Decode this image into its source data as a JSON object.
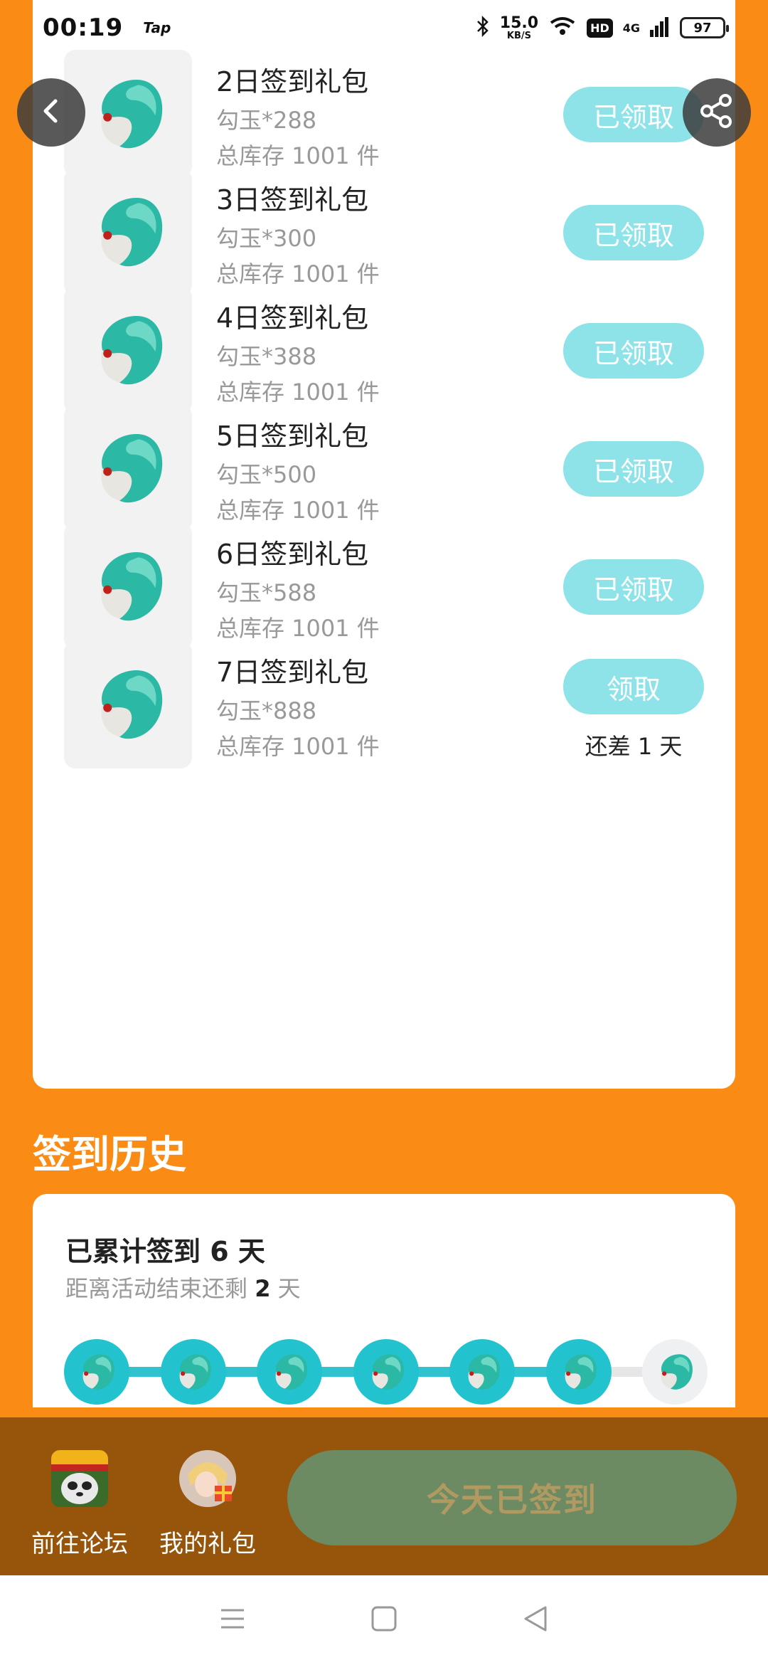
{
  "status_bar": {
    "time": "00:19",
    "app_tag": "Tap",
    "net_speed_value": "15.0",
    "net_speed_unit": "KB/S",
    "hd": "HD",
    "network": "4G",
    "battery": "97"
  },
  "packs": [
    {
      "title": "2日签到礼包",
      "item": "勾玉*288",
      "stock": "总库存 1001 件",
      "button": "已领取",
      "note": ""
    },
    {
      "title": "3日签到礼包",
      "item": "勾玉*300",
      "stock": "总库存 1001 件",
      "button": "已领取",
      "note": ""
    },
    {
      "title": "4日签到礼包",
      "item": "勾玉*388",
      "stock": "总库存 1001 件",
      "button": "已领取",
      "note": ""
    },
    {
      "title": "5日签到礼包",
      "item": "勾玉*500",
      "stock": "总库存 1001 件",
      "button": "已领取",
      "note": ""
    },
    {
      "title": "6日签到礼包",
      "item": "勾玉*588",
      "stock": "总库存 1001 件",
      "button": "已领取",
      "note": ""
    },
    {
      "title": "7日签到礼包",
      "item": "勾玉*888",
      "stock": "总库存 1001 件",
      "button": "领取",
      "note": "还差 1 天"
    }
  ],
  "history": {
    "title": "签到历史",
    "count_prefix": "已累计签到 ",
    "count_value": "6",
    "count_suffix": " 天",
    "remain_prefix": "距离活动结束还剩 ",
    "remain_value": "2",
    "remain_suffix": " 天",
    "days_signed": 6,
    "days_total": 7
  },
  "bottom_bar": {
    "forum_label": "前往论坛",
    "gifts_label": "我的礼包",
    "signed_label": "今天已签到"
  },
  "colors": {
    "background": "#fa8b14",
    "accent_teal": "#22c3cf",
    "button_light_teal": "#8ee3e8",
    "bottom_bar": "#97540b",
    "signed_button": "#6d8b63"
  },
  "icons": {
    "back": "chevron-left-icon",
    "share": "share-icon",
    "pack": "jade-magatama-icon",
    "nav_menu": "menu-icon",
    "nav_home": "home-square-icon",
    "nav_back": "triangle-back-icon"
  }
}
